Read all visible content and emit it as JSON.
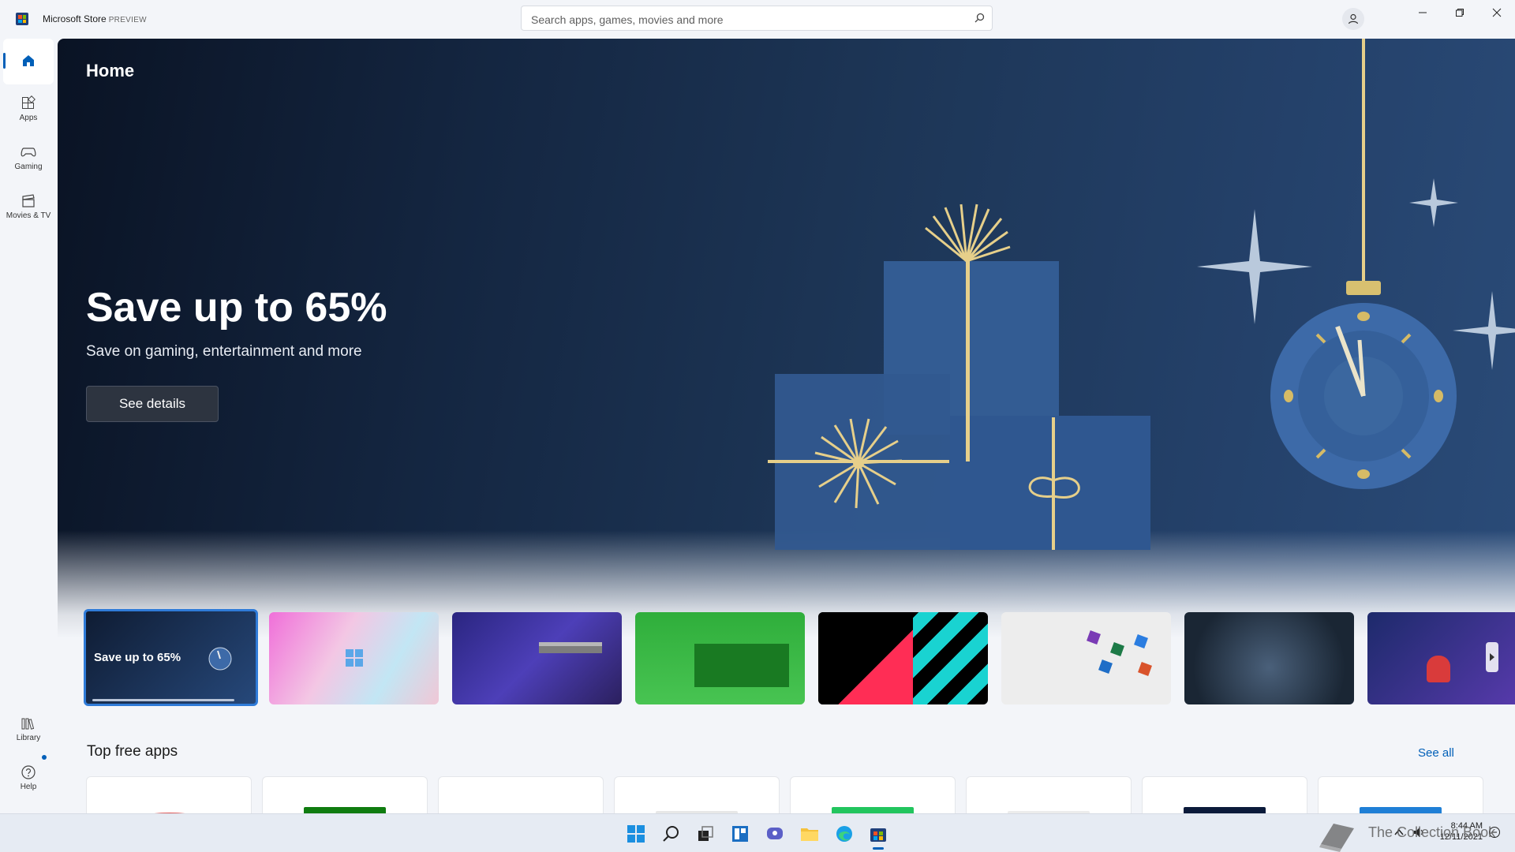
{
  "window": {
    "title": "Microsoft Store",
    "title_badge": "PREVIEW",
    "search_placeholder": "Search apps, games, movies and more"
  },
  "nav": {
    "home": "",
    "apps": "Apps",
    "gaming": "Gaming",
    "movies": "Movies & TV",
    "library": "Library",
    "help": "Help"
  },
  "main": {
    "page_title": "Home",
    "hero": {
      "title": "Save up to 65%",
      "subtitle": "Save on gaming, entertainment and more",
      "button": "See details"
    },
    "carousel": [
      {
        "label": "Save up to 65%",
        "theme": "holiday-sale"
      },
      {
        "label": "",
        "theme": "windows-11"
      },
      {
        "label": "",
        "theme": "minecraft"
      },
      {
        "label": "",
        "theme": "xbox-gamepass"
      },
      {
        "label": "",
        "theme": "tiktok-happy-holidays"
      },
      {
        "label": "",
        "theme": "office-apps"
      },
      {
        "label": "",
        "theme": "venom"
      },
      {
        "label": "",
        "theme": "among-us"
      }
    ],
    "top_free": {
      "title": "Top free apps",
      "see_all": "See all"
    }
  },
  "taskbar": {
    "time": "8:44 AM",
    "date": "12/11/2021"
  },
  "watermark": "The Collection Book",
  "colors": {
    "accent": "#005fb8",
    "hero_dark": "#0a1324",
    "hero_blue": "#24416a",
    "gold": "#e6cf8a"
  }
}
